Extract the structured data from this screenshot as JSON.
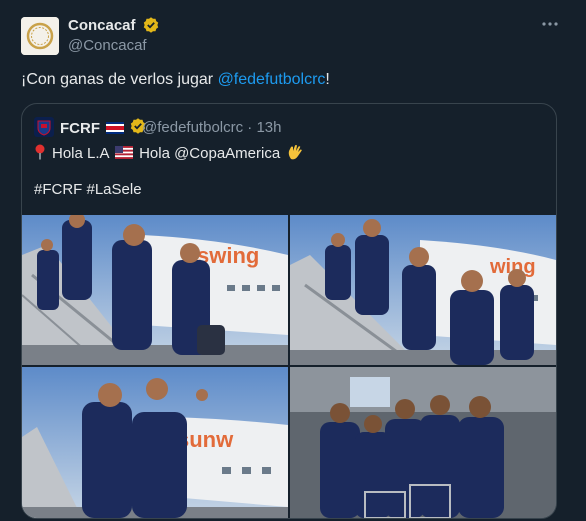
{
  "tweet": {
    "author_name": "Concacaf",
    "author_handle": "@Concacaf",
    "text_before": "¡Con ganas de verlos jugar ",
    "mention": "@fedefutbolcrc",
    "text_after": "!",
    "more_icon": "more-horizontal-icon",
    "verified_color": "#e2b719"
  },
  "quoted": {
    "author_name": "FCRF",
    "author_handle": "@fedefutbolcrc",
    "time": "· 13h",
    "line1_a": "Hola L.A",
    "line1_b": "Hola @CopaAmerica",
    "hashtags": "#FCRF #LaSele",
    "photos": [
      {
        "name": "photo-1",
        "desc_icon": "team-descending-stairs-photo"
      },
      {
        "name": "photo-2",
        "desc_icon": "team-on-stairs-photo"
      },
      {
        "name": "photo-3",
        "desc_icon": "players-waving-photo"
      },
      {
        "name": "photo-4",
        "desc_icon": "group-posing-photo"
      }
    ]
  },
  "colors": {
    "background": "#15202b",
    "link": "#1d9bf0",
    "muted": "#8b98a5",
    "border": "#38444d",
    "jersey": "#1c2b5c"
  }
}
